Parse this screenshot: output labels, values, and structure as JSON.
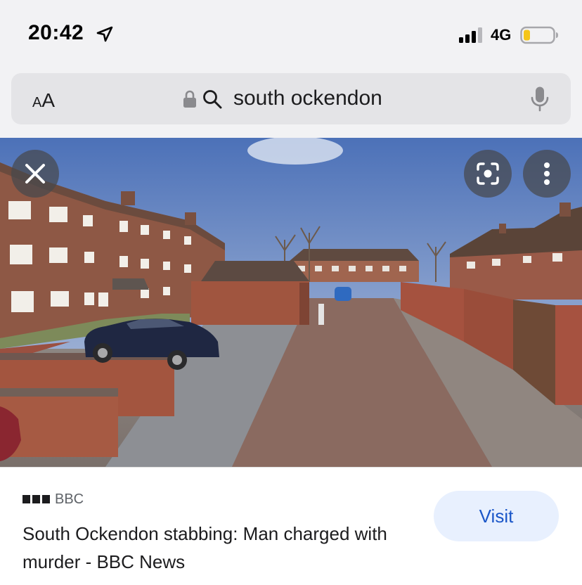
{
  "status_bar": {
    "time": "20:42",
    "network": "4G",
    "icons": [
      "location-arrow-icon",
      "signal-icon",
      "battery-icon"
    ],
    "battery_color": "#f5c518"
  },
  "browser": {
    "text_size_label_small": "A",
    "text_size_label_large": "A",
    "search_query": "south ockendon",
    "icons": [
      "lock-icon",
      "search-icon",
      "microphone-icon"
    ]
  },
  "image_viewer": {
    "icons": [
      "close-icon",
      "lens-icon",
      "more-vertical-icon"
    ]
  },
  "result": {
    "source": "BBC",
    "title": "South Ockendon stabbing: Man charged with murder - BBC News",
    "visit_label": "Visit",
    "accent": "#1a56c8"
  }
}
